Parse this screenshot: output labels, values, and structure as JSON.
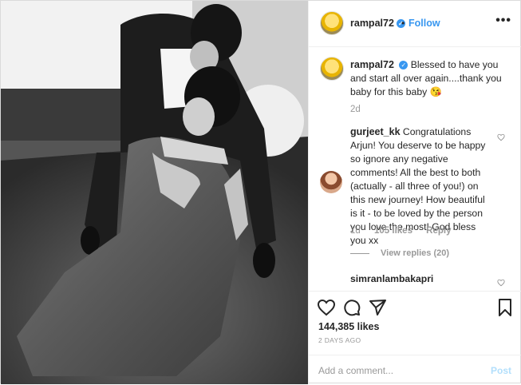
{
  "header": {
    "username": "rampal72",
    "verified_icon": "verified-badge-icon",
    "separator": "•",
    "follow_label": "Follow",
    "more_icon": "ellipsis-icon",
    "more_glyph": "•••"
  },
  "caption": {
    "username": "rampal72",
    "text": "Blessed to have you and start all over again....thank you baby for this baby",
    "emoji": "😘",
    "time": "2d"
  },
  "comments": [
    {
      "username": "gurjeet_kk",
      "text": "Congratulations Arjun! You deserve to be happy so ignore any negative comments! All the best to both (actually - all three of you!) on this new journey! How beautiful is it - to be loved by the person you love the most! God bless you xx",
      "time": "1d",
      "likes": "105 likes",
      "reply_label": "Reply",
      "view_replies": "View replies (20)"
    },
    {
      "username": "simranlambakapri"
    }
  ],
  "actions": {
    "like_icon": "heart-icon",
    "comment_icon": "comment-icon",
    "share_icon": "share-icon",
    "save_icon": "bookmark-icon"
  },
  "stats": {
    "likes": "144,385 likes",
    "posted": "2 DAYS AGO"
  },
  "add_comment": {
    "placeholder": "Add a comment...",
    "post_label": "Post"
  },
  "colors": {
    "link": "#3897f0",
    "muted": "#999999",
    "post_disabled": "#b2dffc"
  }
}
